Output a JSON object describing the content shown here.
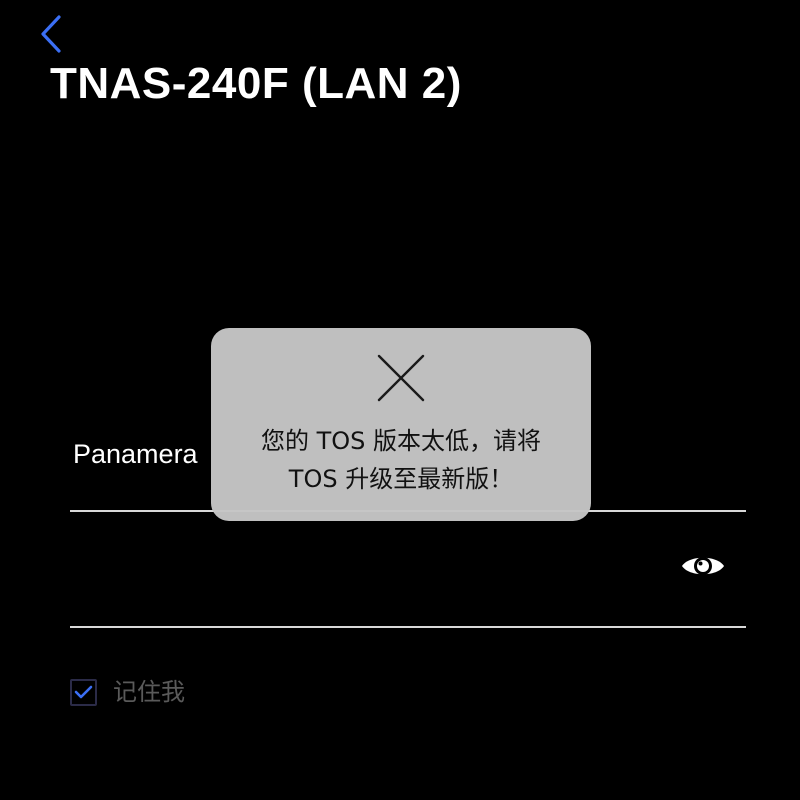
{
  "header": {
    "back_icon": "chevron-left-icon",
    "title": "TNAS-240F (LAN 2)"
  },
  "login_form": {
    "username_value": "Panamera",
    "password_value": "",
    "show_password_icon": "eye-icon",
    "remember_me": {
      "label": "记住我",
      "checked": true
    }
  },
  "toast": {
    "icon": "close-icon",
    "message_line1": "您的 TOS 版本太低，请将",
    "message_line2": "TOS 升级至最新版！"
  },
  "colors": {
    "background": "#000000",
    "accent": "#3b6ff5",
    "toast_background": "#c5c5c5"
  }
}
